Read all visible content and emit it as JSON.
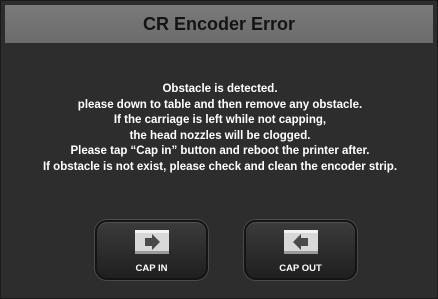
{
  "dialog": {
    "title": "CR Encoder Error",
    "message_lines": [
      "Obstacle is detected.",
      "please down to table and then remove any obstacle.",
      "If the carriage is left while not capping,",
      "the head nozzles will be clogged.",
      "Please tap “Cap in” button and reboot the printer after.",
      "If obstacle is not exist, please check and clean the encoder strip."
    ]
  },
  "buttons": {
    "cap_in": {
      "label": "CAP IN",
      "icon": "arrow-right-icon"
    },
    "cap_out": {
      "label": "CAP OUT",
      "icon": "arrow-left-icon"
    }
  },
  "colors": {
    "background": "#2d2d2d",
    "title_bar": "#747474",
    "title_text": "#141414",
    "text": "#ffffff"
  }
}
